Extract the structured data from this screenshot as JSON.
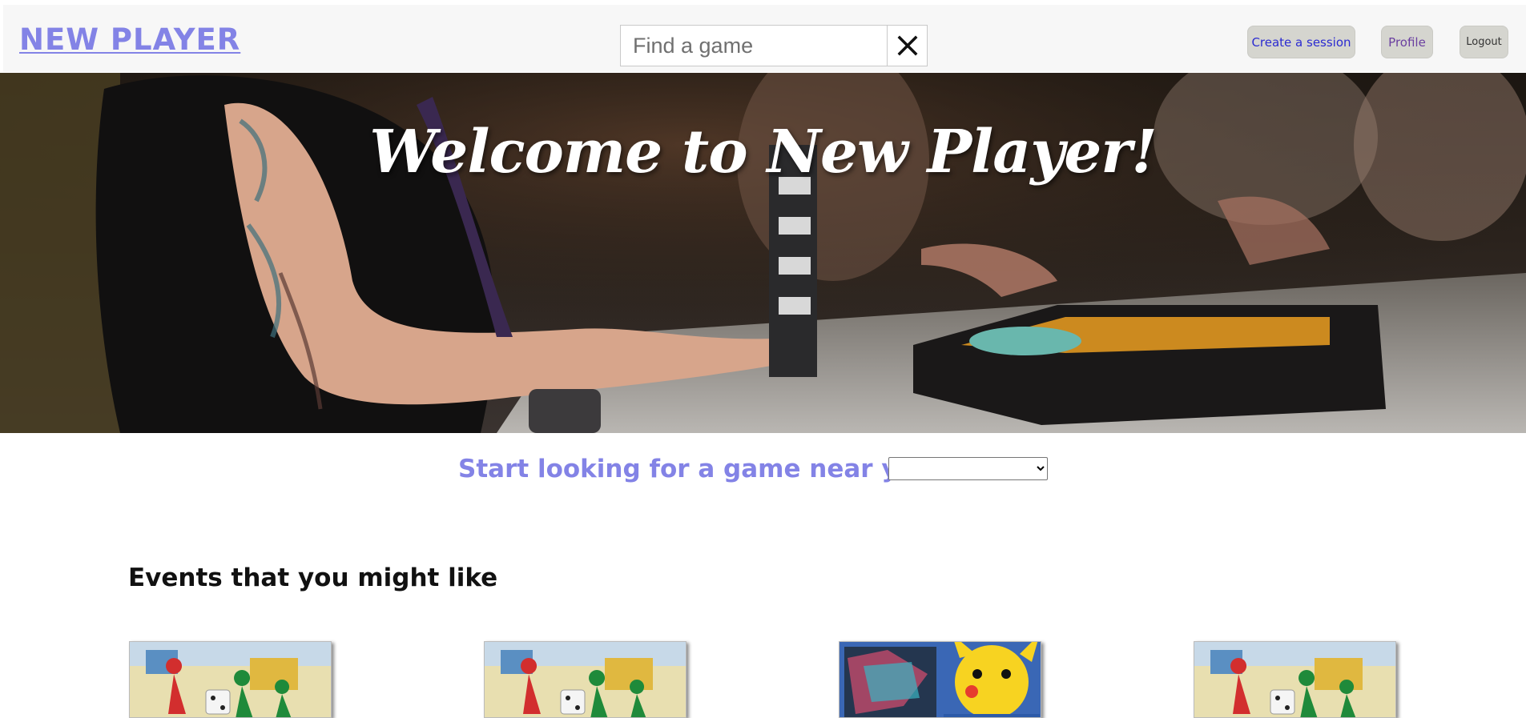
{
  "header": {
    "brand": "NEW PLAYER",
    "search": {
      "placeholder": "Find a game",
      "value": ""
    },
    "clear_icon": "close-icon",
    "buttons": {
      "create_session": "Create a session",
      "profile": "Profile",
      "logout": "Logout"
    }
  },
  "hero": {
    "title": "Welcome to New Player!"
  },
  "locate": {
    "label": "Start looking for a game near you:",
    "selected": ""
  },
  "events": {
    "title": "Events that you might like",
    "cards": [
      {
        "image": "board-game-pawns"
      },
      {
        "image": "board-game-pawns"
      },
      {
        "image": "pokemon-cards-pikachu"
      },
      {
        "image": "board-game-pawns"
      }
    ]
  },
  "colors": {
    "accent": "#8383e6",
    "button_bg": "#d5d5cf",
    "link_blue": "#2b2bd1"
  }
}
